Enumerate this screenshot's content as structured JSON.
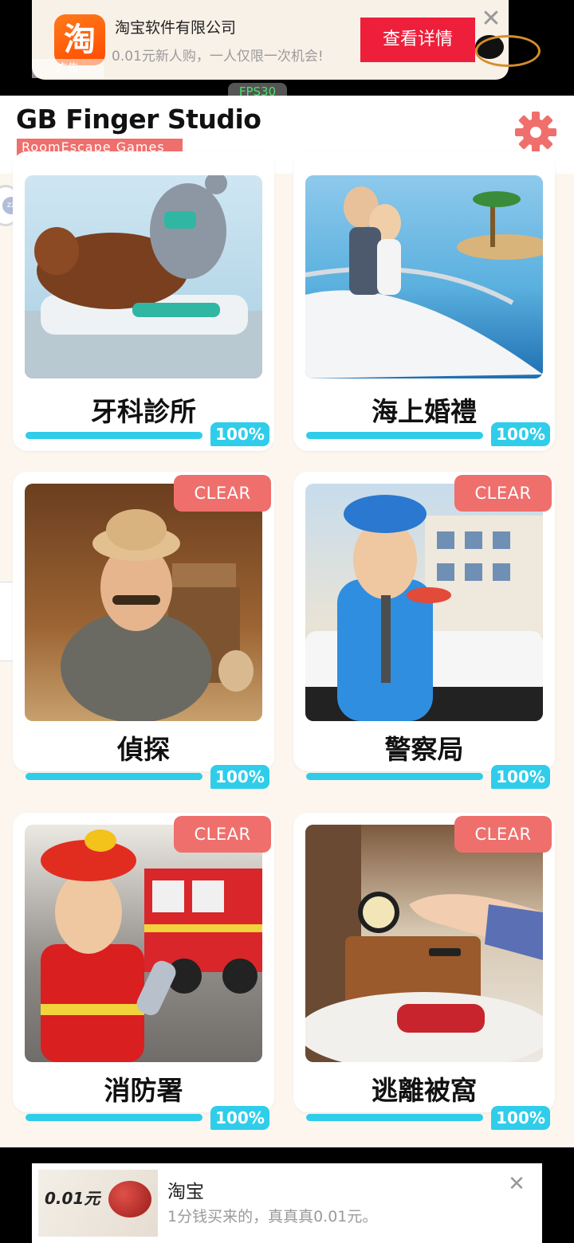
{
  "top_ad": {
    "logo_text": "淘",
    "ad_mark": "广告",
    "title": "淘宝软件有限公司",
    "description": "0.01元新人购，一人仅限一次机会!",
    "cta": "查看详情",
    "close": "✕"
  },
  "fps": "FPS30",
  "header": {
    "brand_title": "GB Finger Studio",
    "brand_subtitle": "RoomEscape  Games"
  },
  "side_bubble": "zz",
  "games": [
    {
      "name": "牙科診所",
      "progress": "100%",
      "progress_value": 1.0,
      "clear": null
    },
    {
      "name": "海上婚禮",
      "progress": "100%",
      "progress_value": 1.0,
      "clear": null
    },
    {
      "name": "偵探",
      "progress": "100%",
      "progress_value": 1.0,
      "clear": "CLEAR"
    },
    {
      "name": "警察局",
      "progress": "100%",
      "progress_value": 1.0,
      "clear": "CLEAR"
    },
    {
      "name": "消防署",
      "progress": "100%",
      "progress_value": 1.0,
      "clear": "CLEAR"
    },
    {
      "name": "逃離被窩",
      "progress": "100%",
      "progress_value": 1.0,
      "clear": "CLEAR"
    }
  ],
  "bottom_ad": {
    "image_price": "0.01元",
    "title": "淘宝",
    "description": "1分钱买来的，真真真0.01元。",
    "close": "✕"
  },
  "colors": {
    "accent": "#ef6f6c",
    "progress": "#2fcdea",
    "cta_red": "#ee1f3b",
    "taobao_orange": "#ff5a00"
  }
}
